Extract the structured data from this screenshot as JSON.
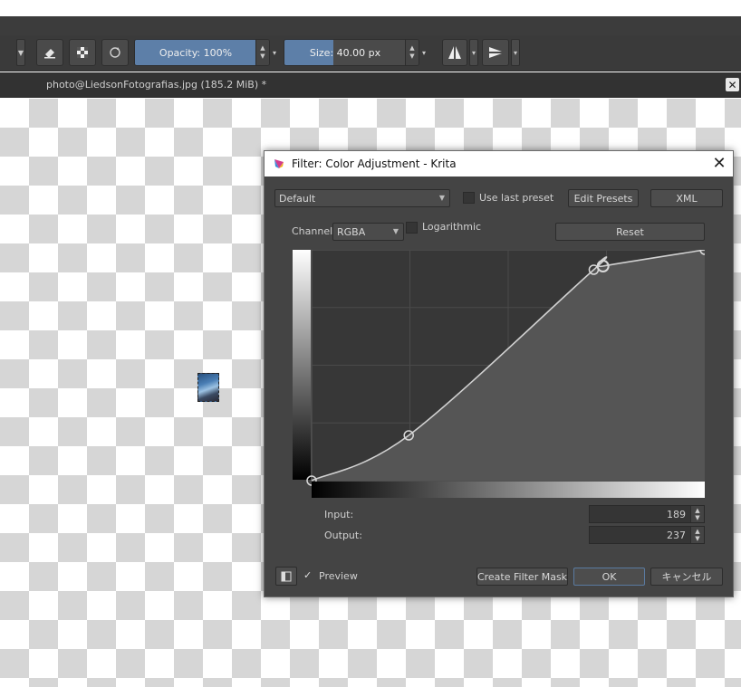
{
  "toolbar": {
    "opacity_label": "Opacity: 100%",
    "opacity_value": 1.0,
    "size_label": "Size: 40.00 px",
    "size_value": 0.4
  },
  "tab": {
    "title": "photo@LiedsonFotografias.jpg (185.2 MiB) *",
    "close_glyph": "✕"
  },
  "dialog": {
    "title": "Filter: Color Adjustment - Krita",
    "close_glyph": "✕",
    "preset": "Default",
    "use_last_preset_label": "Use last preset",
    "use_last_preset_checked": false,
    "edit_presets_label": "Edit Presets",
    "xml_label": "XML",
    "channel_label": "Channel:",
    "channel_value": "RGBA",
    "logarithmic_label": "Logarithmic",
    "logarithmic_checked": false,
    "reset_label": "Reset",
    "input_label": "Input:",
    "input_value": "189",
    "output_label": "Output:",
    "output_value": "237",
    "preview_label": "Preview",
    "preview_checked": true,
    "create_filter_mask_label": "Create Filter Mask",
    "ok_label": "OK",
    "cancel_label": "キャンセル"
  },
  "curve": {
    "points": [
      [
        0,
        0
      ],
      [
        63,
        50
      ],
      [
        183,
        233
      ],
      [
        189,
        237
      ],
      [
        255,
        255
      ]
    ],
    "selected_point_index": 3
  },
  "colors": {
    "toolbar_bg": "#3a3a3a",
    "accent": "#5d7fa8",
    "dialog_bg": "#444444",
    "curve_line": "#d0d0d0"
  },
  "icons": {
    "eraser": "eraser-icon",
    "alpha": "alpha-lock-icon",
    "reload": "reload-icon",
    "mirror_h": "mirror-horizontal-icon",
    "mirror_v": "mirror-vertical-icon",
    "krita": "krita-logo-icon",
    "layout": "split-view-icon"
  }
}
